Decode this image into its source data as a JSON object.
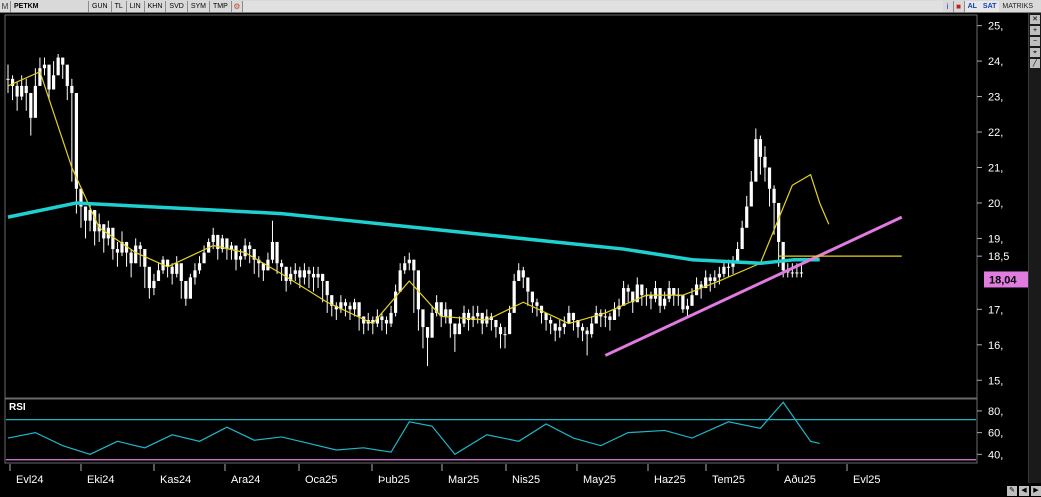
{
  "toolbar": {
    "symbol": "PETKM",
    "buttons": [
      "GUN",
      "TL",
      "LIN",
      "KHN",
      "SVD",
      "SYM",
      "TMP"
    ],
    "buy_label": "AL",
    "sell_label": "SAT",
    "matrix_label": "MATRIKS"
  },
  "colors": {
    "candle": "#ffffff",
    "ma_short": "#e6d21e",
    "ma_long": "#1fd0d0",
    "trendline": "#e07be0",
    "last_price_bg": "#e07be0",
    "support_line": "#e6d21e",
    "rsi_line": "#1fb5c8",
    "rsi_upper": "#1fb5c8",
    "rsi_lower": "#e07be0"
  },
  "chart_data": [
    {
      "type": "line",
      "title": "",
      "x_ticks": [
        "Evl24",
        "Eki24",
        "Kas24",
        "Ara24",
        "Oca25",
        "Þub25",
        "Mar25",
        "Nis25",
        "May25",
        "Haz25",
        "Tem25",
        "Aðu25",
        "Evl25"
      ],
      "y_ticks": [
        "15,",
        "16,",
        "17,",
        "18,5",
        "19,",
        "20,",
        "21,",
        "22,",
        "23,",
        "24,",
        "25,"
      ],
      "ylim": [
        14.5,
        25.3
      ],
      "last_price_label": "18,04",
      "grid": false,
      "series": [
        {
          "kind": "candles",
          "x": [
            0,
            2,
            4,
            6,
            8,
            10,
            12,
            14,
            16,
            18,
            20,
            22,
            24,
            26,
            28,
            30,
            32,
            34,
            36,
            38,
            40,
            42,
            44,
            46,
            48,
            50,
            52,
            54,
            56,
            58,
            60,
            62,
            64,
            66,
            68,
            70,
            72,
            74,
            76,
            78,
            80,
            82,
            84,
            86,
            88,
            90,
            92,
            94,
            96,
            98,
            100,
            102,
            104,
            106,
            108,
            110,
            112,
            114,
            116,
            118,
            120,
            122,
            124,
            126,
            128,
            130,
            132,
            134,
            136,
            138,
            140,
            142,
            144,
            146,
            148,
            150,
            152,
            154,
            156,
            158,
            160,
            162,
            164,
            166,
            168,
            170,
            172,
            174,
            176,
            178,
            180,
            182,
            184,
            186,
            188,
            190,
            192,
            194,
            196,
            198,
            200,
            202,
            204,
            206,
            208,
            210,
            212,
            214,
            216,
            218,
            220,
            222,
            224,
            226,
            228,
            230,
            232,
            234,
            236,
            238,
            240,
            242,
            244,
            246,
            248,
            250,
            252,
            254,
            256,
            258,
            260,
            262,
            264,
            266,
            268,
            270,
            272,
            274,
            276,
            278,
            280,
            282,
            284,
            286,
            288,
            290,
            292,
            294,
            296,
            298,
            300,
            302,
            304,
            306,
            308,
            310,
            312,
            314,
            316,
            318,
            320,
            322,
            324,
            326,
            328,
            330,
            332,
            334,
            336,
            338,
            340,
            342,
            344,
            346,
            348,
            350,
            352,
            354,
            356,
            358,
            360,
            362
          ],
          "close": [
            23.5,
            23.3,
            23.0,
            23.3,
            23.1,
            22.4,
            23.3,
            23.8,
            23.9,
            23.2,
            23.6,
            24.1,
            23.9,
            23.3,
            23.1,
            20.4,
            19.9,
            19.5,
            19.8,
            19.2,
            19.4,
            19.0,
            19.3,
            18.7,
            18.6,
            18.9,
            18.6,
            18.3,
            18.8,
            18.7,
            18.2,
            17.6,
            17.8,
            18.1,
            18.4,
            18.2,
            18.0,
            18.3,
            17.8,
            17.3,
            17.9,
            18.1,
            18.3,
            18.6,
            18.9,
            19.1,
            18.7,
            19.0,
            18.7,
            18.8,
            18.4,
            18.5,
            18.8,
            18.7,
            18.4,
            18.3,
            18.1,
            18.4,
            18.9,
            18.3,
            18.2,
            17.8,
            18.0,
            18.1,
            17.9,
            18.1,
            18.0,
            17.9,
            18.0,
            17.8,
            17.4,
            17.1,
            17.0,
            17.2,
            17.1,
            17.0,
            17.2,
            16.8,
            16.6,
            16.7,
            16.6,
            16.8,
            16.7,
            16.6,
            16.9,
            17.5,
            18.1,
            18.3,
            18.4,
            18.1,
            17.0,
            16.5,
            16.2,
            16.9,
            17.2,
            16.8,
            17.0,
            16.6,
            16.3,
            16.6,
            16.9,
            16.7,
            16.8,
            16.9,
            16.6,
            16.8,
            16.7,
            16.5,
            16.3,
            16.3,
            16.9,
            17.8,
            18.1,
            17.9,
            17.5,
            17.2,
            17.1,
            16.9,
            16.7,
            16.6,
            16.4,
            16.5,
            16.6,
            16.9,
            16.7,
            16.5,
            16.4,
            16.3,
            16.6,
            16.9,
            16.8,
            16.8,
            16.7,
            17.0,
            17.1,
            17.6,
            17.5,
            17.2,
            17.7,
            17.4,
            17.4,
            17.3,
            17.6,
            17.1,
            17.3,
            17.6,
            17.4,
            17.4,
            17.0,
            17.1,
            17.4,
            17.7,
            17.6,
            17.9,
            17.8,
            17.9,
            18.0,
            18.2,
            18.2,
            18.3,
            18.7,
            19.3,
            19.9,
            20.6,
            21.8,
            21.3,
            21.0,
            20.4,
            20.0,
            18.9,
            18.1,
            18.04,
            18.04,
            18.04,
            18.04
          ],
          "high": [
            23.9,
            23.6,
            23.4,
            23.6,
            23.5,
            23.1,
            23.8,
            24.1,
            24.1,
            23.7,
            24.0,
            24.2,
            24.1,
            23.7,
            23.5,
            20.9,
            20.3,
            19.9,
            20.0,
            19.6,
            19.7,
            19.4,
            19.5,
            19.1,
            18.9,
            19.2,
            18.9,
            18.7,
            19.0,
            18.9,
            18.6,
            18.1,
            18.0,
            18.3,
            18.5,
            18.4,
            18.3,
            18.5,
            18.1,
            17.7,
            18.0,
            18.3,
            18.5,
            18.8,
            19.0,
            19.3,
            19.0,
            19.1,
            19.0,
            18.9,
            18.7,
            18.7,
            19.0,
            18.9,
            18.6,
            18.5,
            18.3,
            18.6,
            19.5,
            18.7,
            18.4,
            18.1,
            18.2,
            18.3,
            18.2,
            18.3,
            18.2,
            18.2,
            18.2,
            18.0,
            17.8,
            17.3,
            17.2,
            17.4,
            17.3,
            17.2,
            17.3,
            17.1,
            16.8,
            16.9,
            16.8,
            17.0,
            16.9,
            16.8,
            17.1,
            17.7,
            18.3,
            18.5,
            18.6,
            18.4,
            17.5,
            16.9,
            16.5,
            17.1,
            17.4,
            17.1,
            17.2,
            16.9,
            16.6,
            16.8,
            17.1,
            17.0,
            17.1,
            17.1,
            16.9,
            17.0,
            16.9,
            16.7,
            16.6,
            16.5,
            17.1,
            18.0,
            18.3,
            18.2,
            17.8,
            17.4,
            17.3,
            17.1,
            16.9,
            16.8,
            16.6,
            16.7,
            16.8,
            17.1,
            16.9,
            16.7,
            16.6,
            16.5,
            16.8,
            17.1,
            17.0,
            17.0,
            16.9,
            17.2,
            17.3,
            17.8,
            17.7,
            17.5,
            17.9,
            17.6,
            17.6,
            17.5,
            17.8,
            17.4,
            17.5,
            17.8,
            17.6,
            17.6,
            17.3,
            17.3,
            17.6,
            17.9,
            17.8,
            18.1,
            18.0,
            18.1,
            18.2,
            18.4,
            18.4,
            18.5,
            18.9,
            19.5,
            20.2,
            20.9,
            22.1,
            21.9,
            21.6,
            21.0,
            20.5,
            19.5,
            18.6,
            18.3,
            18.3,
            18.3,
            18.3
          ],
          "low": [
            23.1,
            22.9,
            22.6,
            22.9,
            22.6,
            21.9,
            22.8,
            23.4,
            23.6,
            22.9,
            23.2,
            23.7,
            23.5,
            22.9,
            20.6,
            19.7,
            19.3,
            19.0,
            19.2,
            18.8,
            18.9,
            18.6,
            18.8,
            18.4,
            18.2,
            18.5,
            18.2,
            17.9,
            18.3,
            18.2,
            17.6,
            17.3,
            17.4,
            17.8,
            18.0,
            17.9,
            17.7,
            17.9,
            17.3,
            17.1,
            17.4,
            17.7,
            18.0,
            18.3,
            18.6,
            18.7,
            18.4,
            18.6,
            18.4,
            18.4,
            18.1,
            18.2,
            18.4,
            18.3,
            18.0,
            17.9,
            17.8,
            18.1,
            18.3,
            18.0,
            17.8,
            17.5,
            17.7,
            17.8,
            17.6,
            17.7,
            17.6,
            17.5,
            17.6,
            17.2,
            16.9,
            16.8,
            16.7,
            16.9,
            16.8,
            16.7,
            16.8,
            16.4,
            16.3,
            16.4,
            16.3,
            16.5,
            16.4,
            16.3,
            16.5,
            16.8,
            17.6,
            18.0,
            18.1,
            16.9,
            16.4,
            15.9,
            15.4,
            16.4,
            16.8,
            16.5,
            16.6,
            16.2,
            15.8,
            16.3,
            16.5,
            16.4,
            16.5,
            16.6,
            16.3,
            16.5,
            16.4,
            16.2,
            15.9,
            15.9,
            16.4,
            17.2,
            17.8,
            17.6,
            17.1,
            16.9,
            16.8,
            16.6,
            16.4,
            16.3,
            16.1,
            16.2,
            16.3,
            16.6,
            16.4,
            16.2,
            16.1,
            15.7,
            16.2,
            16.6,
            16.5,
            16.5,
            16.4,
            16.7,
            16.8,
            17.2,
            17.2,
            16.9,
            17.3,
            17.1,
            17.1,
            17.0,
            17.2,
            16.9,
            17.0,
            17.2,
            17.1,
            17.1,
            16.9,
            16.8,
            17.1,
            17.4,
            17.3,
            17.6,
            17.5,
            17.6,
            17.7,
            17.9,
            17.9,
            18.0,
            18.4,
            18.9,
            19.5,
            20.0,
            20.9,
            20.8,
            20.6,
            19.9,
            19.1,
            18.2,
            17.9,
            17.9,
            17.9,
            17.9,
            17.9
          ]
        },
        {
          "kind": "ma_short",
          "x": [
            0,
            14,
            28,
            40,
            56,
            70,
            90,
            104,
            120,
            140,
            160,
            176,
            190,
            210,
            226,
            246,
            262,
            280,
            296,
            312,
            330,
            344,
            352,
            356,
            360
          ],
          "y": [
            23.3,
            23.7,
            21.0,
            19.3,
            18.6,
            18.2,
            18.8,
            18.6,
            18.0,
            17.2,
            16.6,
            17.8,
            16.8,
            16.7,
            17.2,
            16.6,
            16.9,
            17.4,
            17.4,
            17.8,
            18.3,
            20.5,
            20.8,
            20.0,
            19.4
          ]
        },
        {
          "kind": "ma_long",
          "x": [
            0,
            30,
            60,
            90,
            120,
            150,
            180,
            210,
            240,
            270,
            300,
            330,
            345,
            356
          ],
          "y": [
            19.6,
            20.0,
            19.9,
            19.8,
            19.7,
            19.5,
            19.3,
            19.1,
            18.9,
            18.7,
            18.4,
            18.3,
            18.4,
            18.4
          ]
        },
        {
          "kind": "trendline",
          "x": [
            262,
            392
          ],
          "y": [
            15.7,
            19.6
          ]
        },
        {
          "kind": "support",
          "x": [
            338,
            392
          ],
          "y": [
            18.5,
            18.5
          ]
        }
      ]
    },
    {
      "type": "line",
      "title": "RSI",
      "y_ticks": [
        "80,",
        "60,",
        "40,"
      ],
      "ylim": [
        32,
        91
      ],
      "levels": [
        72,
        35
      ],
      "series": [
        {
          "kind": "rsi",
          "x": [
            0,
            12,
            24,
            36,
            48,
            60,
            72,
            84,
            96,
            108,
            120,
            132,
            144,
            156,
            168,
            176,
            186,
            196,
            210,
            224,
            236,
            248,
            260,
            272,
            288,
            300,
            316,
            330,
            340,
            352,
            356
          ],
          "y": [
            55,
            60,
            48,
            40,
            52,
            46,
            58,
            52,
            65,
            53,
            56,
            50,
            44,
            46,
            42,
            70,
            66,
            40,
            58,
            52,
            68,
            55,
            48,
            60,
            62,
            55,
            70,
            64,
            88,
            52,
            50
          ]
        }
      ]
    }
  ]
}
